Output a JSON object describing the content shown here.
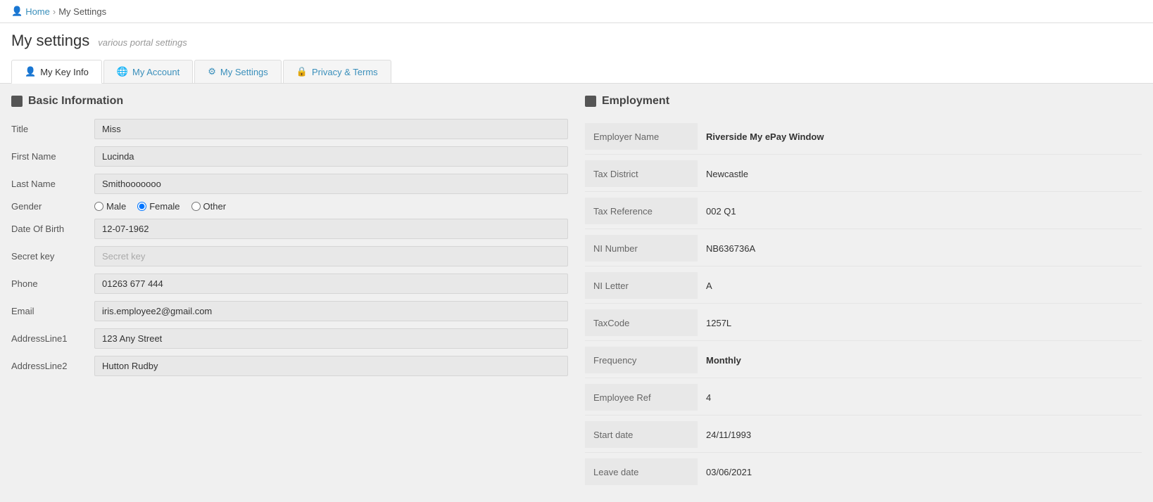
{
  "breadcrumb": {
    "home": "Home",
    "current": "My Settings"
  },
  "page": {
    "title": "My settings",
    "subtitle": "various portal settings"
  },
  "tabs": [
    {
      "id": "key-info",
      "label": "My Key Info",
      "icon": "person",
      "active": true
    },
    {
      "id": "account",
      "label": "My Account",
      "icon": "globe",
      "active": false
    },
    {
      "id": "settings",
      "label": "My Settings",
      "icon": "settings",
      "active": false
    },
    {
      "id": "privacy",
      "label": "Privacy & Terms",
      "icon": "lock",
      "active": false
    }
  ],
  "basic_info": {
    "section_title": "Basic Information",
    "fields": [
      {
        "label": "Title",
        "value": "Miss",
        "placeholder": ""
      },
      {
        "label": "First Name",
        "value": "Lucinda",
        "placeholder": ""
      },
      {
        "label": "Last Name",
        "value": "Smithooooooo",
        "placeholder": ""
      },
      {
        "label": "Date Of Birth",
        "value": "12-07-1962",
        "placeholder": ""
      },
      {
        "label": "Secret key",
        "value": "",
        "placeholder": "Secret key"
      },
      {
        "label": "Phone",
        "value": "01263 677 444",
        "placeholder": ""
      },
      {
        "label": "Email",
        "value": "iris.employee2@gmail.com",
        "placeholder": ""
      },
      {
        "label": "AddressLine1",
        "value": "123 Any Street",
        "placeholder": ""
      },
      {
        "label": "AddressLine2",
        "value": "Hutton Rudby",
        "placeholder": ""
      }
    ],
    "gender": {
      "label": "Gender",
      "options": [
        "Male",
        "Female",
        "Other"
      ],
      "selected": "Female"
    }
  },
  "employment": {
    "section_title": "Employment",
    "fields": [
      {
        "label": "Employer Name",
        "value": "Riverside My ePay Window",
        "bold": true
      },
      {
        "label": "Tax District",
        "value": "Newcastle",
        "bold": false
      },
      {
        "label": "Tax Reference",
        "value": "002 Q1",
        "bold": false
      },
      {
        "label": "NI Number",
        "value": "NB636736A",
        "bold": false
      },
      {
        "label": "NI Letter",
        "value": "A",
        "bold": false
      },
      {
        "label": "TaxCode",
        "value": "1257L",
        "bold": false
      },
      {
        "label": "Frequency",
        "value": "Monthly",
        "bold": true
      },
      {
        "label": "Employee Ref",
        "value": "4",
        "bold": false
      },
      {
        "label": "Start date",
        "value": "24/11/1993",
        "bold": false
      },
      {
        "label": "Leave date",
        "value": "03/06/2021",
        "bold": false
      }
    ]
  }
}
